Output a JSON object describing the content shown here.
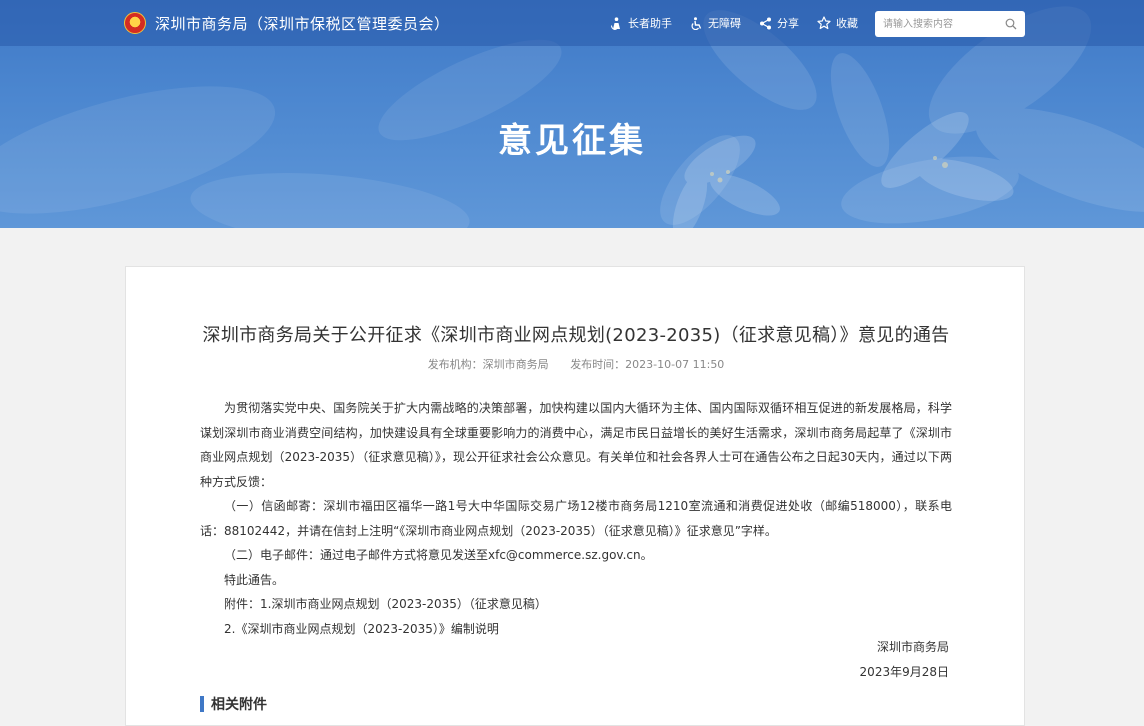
{
  "header": {
    "site_name": "深圳市商务局（深圳市保税区管理委员会）",
    "tools": {
      "elder": "长者助手",
      "accessibility": "无障碍",
      "share": "分享",
      "favorite": "收藏"
    },
    "search": {
      "placeholder": "请输入搜索内容",
      "value": ""
    },
    "banner_title": "意见征集"
  },
  "article": {
    "title": "深圳市商务局关于公开征求《深圳市商业网点规划(2023-2035)（征求意见稿）》意见的通告",
    "meta": {
      "publisher": "发布机构：深圳市商务局",
      "time": "发布时间：2023-10-07 11:50"
    },
    "paragraphs": {
      "p1": "为贯彻落实党中央、国务院关于扩大内需战略的决策部署，加快构建以国内大循环为主体、国内国际双循环相互促进的新发展格局，科学谋划深圳市商业消费空间结构，加快建设具有全球重要影响力的消费中心，满足市民日益增长的美好生活需求，深圳市商务局起草了《深圳市商业网点规划（2023-2035）（征求意见稿）》，现公开征求社会公众意见。有关单位和社会各界人士可在通告公布之日起30天内，通过以下两种方式反馈：",
      "p2": "（一）信函邮寄：深圳市福田区福华一路1号大中华国际交易广场12楼市商务局1210室流通和消费促进处收（邮编518000），联系电话：88102442，并请在信封上注明“《深圳市商业网点规划（2023-2035）（征求意见稿）》征求意见”字样。",
      "p3": "（二）电子邮件：通过电子邮件方式将意见发送至xfc@commerce.sz.gov.cn。",
      "p4": "特此通告。",
      "p5": "附件：1.深圳市商业网点规划（2023-2035）（征求意见稿）",
      "p6": "2.《深圳市商业网点规划（2023-2035）》编制说明"
    },
    "signature": {
      "org": "深圳市商务局",
      "date": "2023年9月28日"
    },
    "related_title": "相关附件"
  },
  "colors": {
    "banner": "#4b86cf",
    "accent": "#3f78c6"
  }
}
